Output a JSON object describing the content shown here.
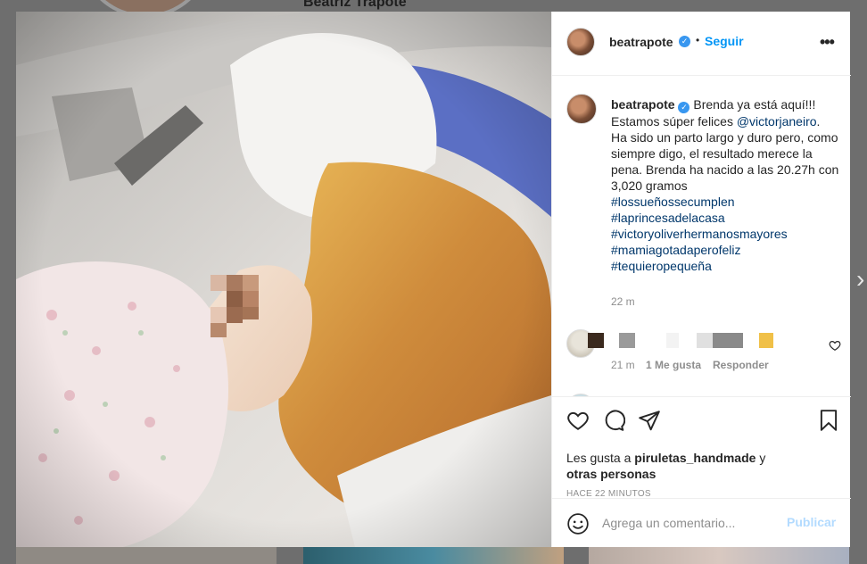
{
  "background": {
    "profile_name": "Beatriz Trapote"
  },
  "post": {
    "author": "beatrapote",
    "follow_label": "Seguir",
    "dot": "•",
    "more_label": "•••",
    "caption": {
      "username": "beatrapote",
      "text_1": "Brenda ya está aquí!!! Estamos súper felices ",
      "mention": "@victorjaneiro",
      "text_2": ". Ha sido un parto largo y duro pero, como siempre digo, el resultado merece la pena. Brenda ha nacido a las 20.27h con 3,020 gramos",
      "hashtags": [
        "#lossueñossecumplen",
        "#laprincesadelacasa",
        "#victoryoliverhermanosmayores",
        "#mamiagotadaperofeliz",
        "#tequieropequeña"
      ],
      "time": "22 m"
    },
    "comments": [
      {
        "time": "21 m",
        "likes": "1 Me gusta",
        "reply_label": "Responder"
      }
    ],
    "likes": {
      "prefix": "Les gusta a ",
      "user": "piruletas_handmade",
      "conj": " y",
      "others": "otras personas"
    },
    "posted_ago": "HACE 22 MINUTOS",
    "add_comment": {
      "placeholder": "Agrega un comentario...",
      "publish_label": "Publicar"
    }
  },
  "colors": {
    "link_blue": "#0095f6",
    "hashtag_blue": "#00376b",
    "verified_blue": "#3897f0",
    "muted": "#8e8e8e",
    "publish_disabled": "#b3dbff"
  },
  "icons": {
    "verified": "verified-badge-icon",
    "more": "more-options-icon",
    "like": "heart-icon",
    "comment": "comment-bubble-icon",
    "share": "paper-plane-icon",
    "save": "bookmark-icon",
    "emoji": "emoji-icon",
    "next": "chevron-right-icon"
  }
}
